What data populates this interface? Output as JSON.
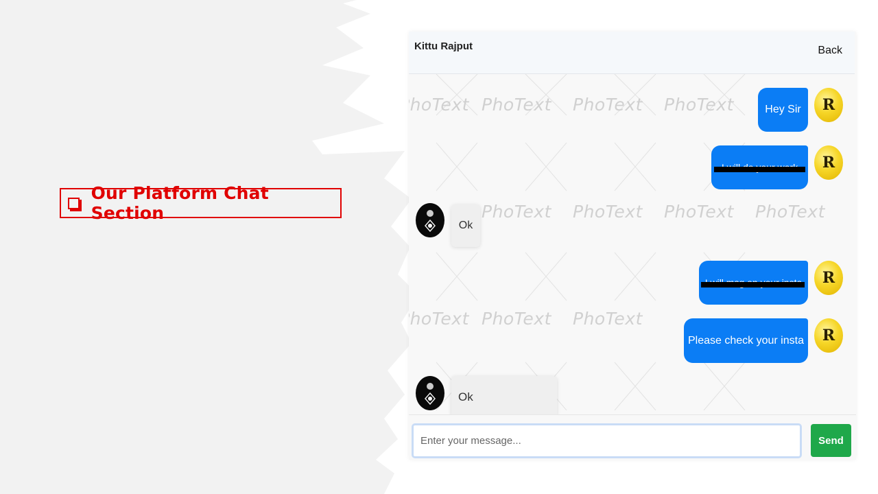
{
  "slide": {
    "heading": "Our Platform Chat Section"
  },
  "chat": {
    "contact_name": "Kittu Rajput",
    "back_label": "Back",
    "watermark": "PhoText",
    "messages": [
      {
        "direction": "out",
        "text": "Hey Sir",
        "redacted": false
      },
      {
        "direction": "out",
        "text": "I will do your work",
        "redacted": true
      },
      {
        "direction": "in",
        "text": "Ok",
        "redacted": false
      },
      {
        "direction": "out",
        "text": "I will msg on your insta",
        "redacted": true
      },
      {
        "direction": "out",
        "text": "Please check your insta",
        "redacted": false
      },
      {
        "direction": "in",
        "text": "Ok",
        "redacted": false
      }
    ],
    "avatar_out_letter": "R",
    "composer": {
      "placeholder": "Enter your message...",
      "send_label": "Send"
    }
  },
  "colors": {
    "accent_red": "#e00000",
    "bubble_blue": "#0b7df5",
    "send_green": "#1fa84a"
  }
}
